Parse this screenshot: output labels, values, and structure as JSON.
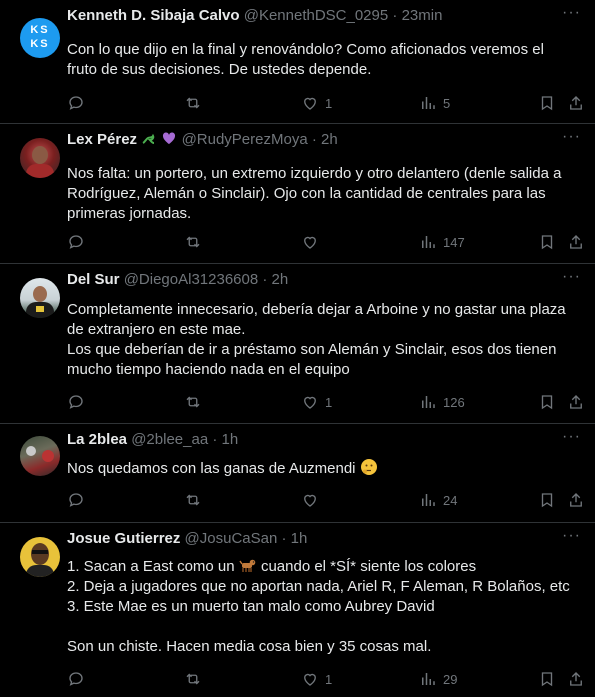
{
  "tweets": [
    {
      "name": "Kenneth D. Sibaja Calvo",
      "handle": "@KennethDSC_0295",
      "time": "23min",
      "avatar_text": "KS KS",
      "lines": [
        "Con lo que dijo en la final y renovándolo? Como aficionados veremos el",
        "fruto de sus decisiones. De ustedes depende."
      ],
      "likes": "1",
      "views": "5"
    },
    {
      "name": "Lex Pérez",
      "handle": "@RudyPerezMoya",
      "time": "2h",
      "lines": [
        "Nos falta: un portero, un extremo izquierdo y otro delantero (denle salida a",
        "Rodríguez, Alemán o Sinclair). Ojo con la cantidad de centrales para las",
        "primeras jornadas."
      ],
      "likes": "",
      "views": "147"
    },
    {
      "name": "Del Sur",
      "handle": "@DiegoAl31236608",
      "time": "2h",
      "lines": [
        "Completamente innecesario, debería dejar a Arboine y no gastar una plaza",
        "de extranjero en este mae.",
        "Los que deberían de ir a préstamo son Alemán y Sinclair, esos dos tienen",
        "mucho tiempo haciendo nada en el equipo"
      ],
      "likes": "1",
      "views": "126"
    },
    {
      "name": "La 2blea",
      "handle": "@2blee_aa",
      "time": "1h",
      "lines": [
        "Nos quedamos con las ganas de Auzmendi"
      ],
      "likes": "",
      "views": "24"
    },
    {
      "name": "Josue Gutierrez",
      "handle": "@JosuCaSan",
      "time": "1h",
      "lines": [
        "1. Sacan a East como un",
        "cuando el *SÍ* siente los colores",
        "2. Deja a jugadores que no aportan nada, Ariel R, F Aleman, R Bolaños, etc",
        "3. Este Mae es un muerto tan malo como Aubrey David",
        "",
        "Son un chiste. Hacen media cosa bien y 35 cosas mal."
      ],
      "likes": "1",
      "views": "29"
    }
  ],
  "more_label": "···",
  "colors": {
    "background": "#000000",
    "text": "#e7e9ea",
    "muted": "#71767b",
    "border": "#2f3336",
    "avatar_ks": "#1d9bf0"
  }
}
